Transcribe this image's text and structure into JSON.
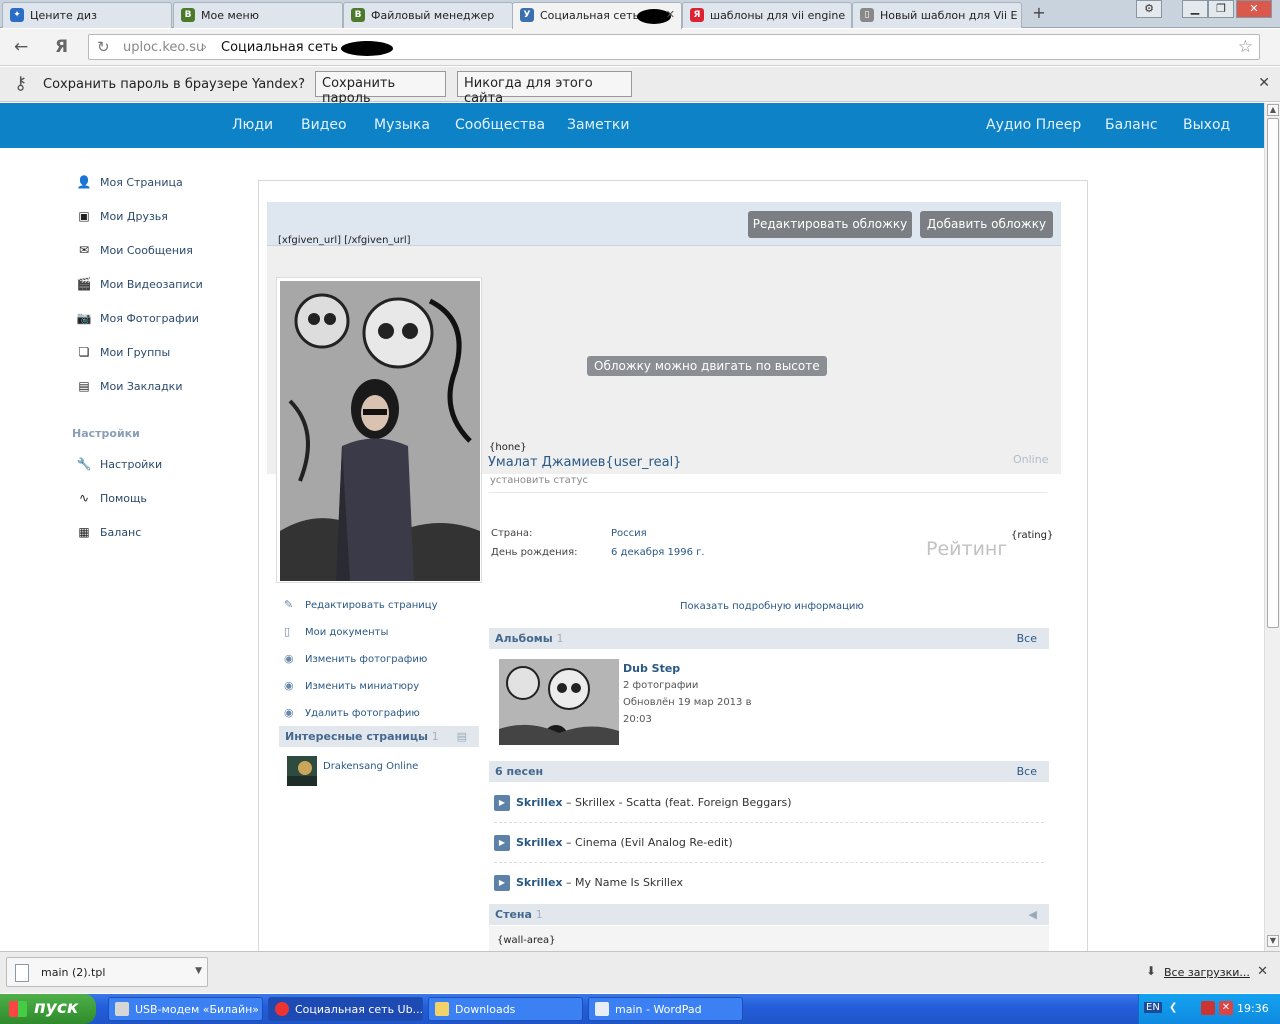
{
  "browser": {
    "tabs": [
      {
        "label": "Цените диз",
        "fav_color": "#2b6cc4",
        "fav_glyph": "✦"
      },
      {
        "label": "Мое меню",
        "fav_color": "#4a7a2a",
        "fav_glyph": "B"
      },
      {
        "label": "Файловый менеджер",
        "fav_color": "#4a7a2a",
        "fav_glyph": "B"
      },
      {
        "label": "Социальная сеть",
        "fav_color": "#3a6fb0",
        "fav_glyph": "У"
      },
      {
        "label": "шаблоны для vii engine",
        "fav_color": "#d23",
        "fav_glyph": "Я"
      },
      {
        "label": "Новый шаблон для Vii E",
        "fav_color": "#888",
        "fav_glyph": "▯"
      }
    ],
    "address": {
      "domain": "uploc.keo.su",
      "separator": "›",
      "page_title": "Социальная сеть"
    },
    "password_bar": {
      "message": "Сохранить пароль в браузере Yandex?",
      "save_label": "Сохранить пароль",
      "never_label": "Никогда для этого сайта"
    }
  },
  "site": {
    "nav_left": [
      "Люди",
      "Видео",
      "Музыка",
      "Сообщества",
      "Заметки"
    ],
    "nav_right": [
      "Аудио Плеер",
      "Баланс",
      "Выход"
    ],
    "menu": [
      {
        "label": "Моя Страница",
        "icon": "user-icon"
      },
      {
        "label": "Мои Друзья",
        "icon": "id-card-icon"
      },
      {
        "label": "Мои Сообщения",
        "icon": "envelope-icon"
      },
      {
        "label": "Мои Видеозаписи",
        "icon": "film-icon"
      },
      {
        "label": "Моя Фотографии",
        "icon": "camera-icon"
      },
      {
        "label": "Мои Группы",
        "icon": "groups-icon"
      },
      {
        "label": "Мои Закладки",
        "icon": "bookmarks-icon"
      }
    ],
    "settings_head": "Настройки",
    "settings_menu": [
      {
        "label": "Настройки",
        "icon": "wrench-icon"
      },
      {
        "label": "Помощь",
        "icon": "pulse-icon"
      },
      {
        "label": "Баланс",
        "icon": "calculator-icon"
      }
    ]
  },
  "profile": {
    "edit_cover": "Редактировать обложку",
    "add_cover": "Добавить обложку",
    "xfgiven": "[xfgiven_url] [/xfgiven_url]",
    "drag_note": "Обложку можно двигать по высоте",
    "hone": "{hone}",
    "name": "Умалат Джамиев{user_real}",
    "online": "Online",
    "status": "установить статус",
    "country_label": "Страна:",
    "country_value": "Россия",
    "birthday_label": "День рождения:",
    "birthday_value": "6 декабря 1996 г.",
    "rating_label": "Рейтинг",
    "rating_tag": "{rating}",
    "show_more": "Показать подробную информацию",
    "actions": [
      {
        "label": "Редактировать страницу",
        "icon": "edit-icon"
      },
      {
        "label": "Мои документы",
        "icon": "document-icon"
      },
      {
        "label": "Изменить фотографию",
        "icon": "camera-icon"
      },
      {
        "label": "Изменить миниатюру",
        "icon": "camera-icon"
      },
      {
        "label": "Удалить фотографию",
        "icon": "camera-delete-icon"
      }
    ],
    "interesting": {
      "title": "Интересные страницы",
      "count": "1",
      "item": "Drakensang Online"
    },
    "albums": {
      "title": "Альбомы",
      "count": "1",
      "all": "Все",
      "album_title": "Dub Step",
      "album_count": "2 фотографии",
      "album_updated_1": "Обновлён 19 мар 2013 в",
      "album_updated_2": "20:03"
    },
    "songs": {
      "title": "6 песен",
      "all": "Все",
      "items": [
        {
          "artist": "Skrillex",
          "title": " – Skrillex - Scatta (feat. Foreign Beggars)"
        },
        {
          "artist": "Skrillex",
          "title": " – Cinema (Evil Analog Re-edit)"
        },
        {
          "artist": "Skrillex",
          "title": " – My Name Is Skrillex"
        }
      ]
    },
    "wall": {
      "title": "Стена",
      "count": "1",
      "area": "{wall-area}"
    }
  },
  "downloads": {
    "file": "main (2).tpl",
    "all": "Все загрузки..."
  },
  "taskbar": {
    "start": "пуск",
    "tasks": [
      "USB-модем «Билайн»",
      "Социальная сеть Ub...",
      "Downloads",
      "main - WordPad"
    ],
    "lang": "EN",
    "clock": "19:36"
  },
  "colors": {
    "nav_bg": "#0d82c7",
    "link": "#2a5885"
  }
}
